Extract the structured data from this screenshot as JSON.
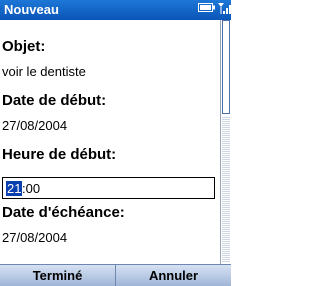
{
  "titlebar": {
    "title": "Nouveau",
    "battery_icon": "battery-icon",
    "signal_icon": "signal-strength-icon",
    "color": "#0a55b8"
  },
  "fields": {
    "objet_label": "Objet:",
    "objet_value": "voir le dentiste",
    "date_debut_label": "Date de début:",
    "date_debut_value": "27/08/2004",
    "heure_debut_label": "Heure de début:",
    "heure_debut_hours": "21",
    "heure_debut_rest": ":00",
    "date_echeance_label": "Date d'échéance:",
    "date_echeance_value": "27/08/2004"
  },
  "softkeys": {
    "left_label": "Terminé",
    "right_label": "Annuler"
  }
}
